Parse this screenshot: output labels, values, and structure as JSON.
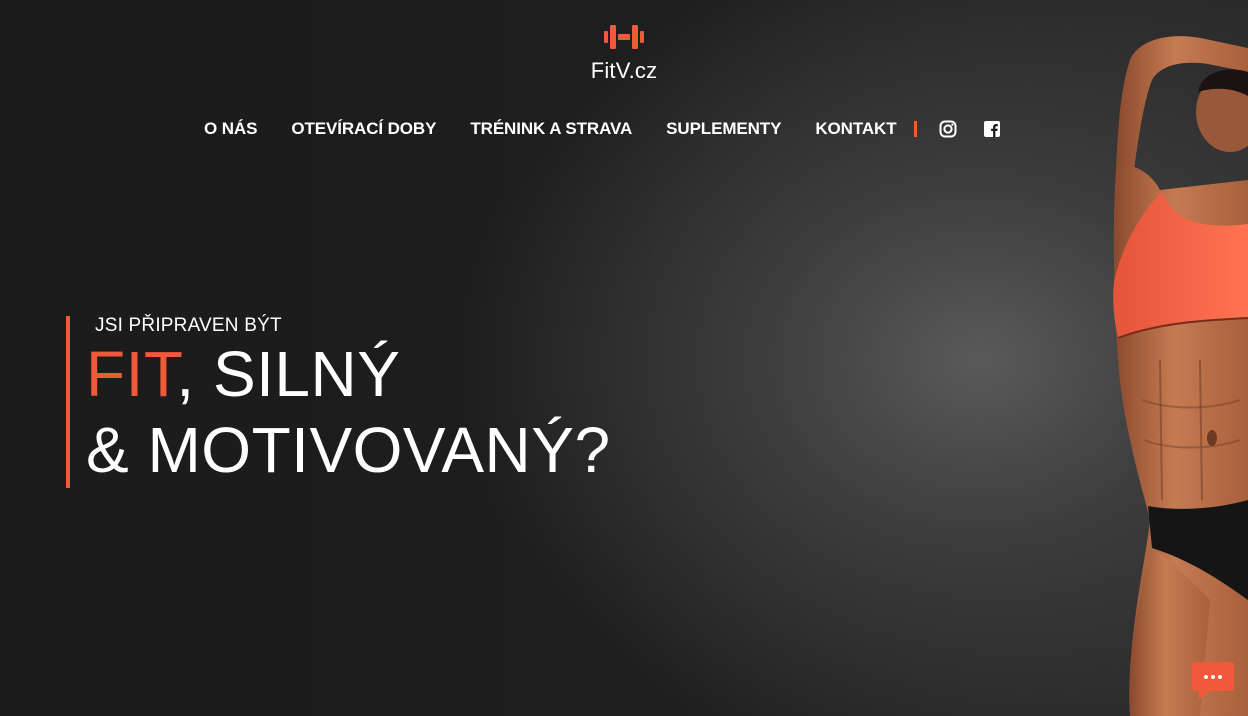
{
  "brand": {
    "name": "FitV.cz",
    "logo_icon": "dumbbell-icon",
    "accent_color": "#f05a3a"
  },
  "nav": {
    "items": [
      {
        "label": "O NÁS"
      },
      {
        "label": "OTEVÍRACÍ DOBY"
      },
      {
        "label": "TRÉNINK A STRAVA"
      },
      {
        "label": "SUPLEMENTY"
      },
      {
        "label": "KONTAKT"
      }
    ],
    "social": [
      {
        "icon": "instagram-icon"
      },
      {
        "icon": "facebook-icon"
      }
    ]
  },
  "hero": {
    "pre_title": "JSI PŘIPRAVEN BÝT",
    "line1_accent": "FIT",
    "line1_rest": ", SILNÝ",
    "line2": "& MOTIVOVANÝ?"
  },
  "chat": {
    "icon": "chat-icon"
  }
}
